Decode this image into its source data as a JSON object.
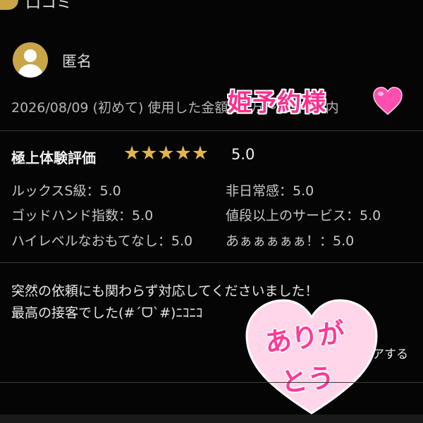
{
  "header": {
    "label": "口コミ"
  },
  "reviewer": {
    "name": "匿名"
  },
  "visit_line": "2026/08/09 (初めて) 使用した金額：1万〜2万円以内",
  "sticker_top": {
    "text": "姫予約様",
    "emoji": "heart"
  },
  "rating": {
    "title": "極上体験評価",
    "stars": "★★★★★",
    "score": "5.0"
  },
  "details": [
    {
      "label": "ルックスS級：5.0"
    },
    {
      "label": "非日常感：5.0"
    },
    {
      "label": "ゴッドハンド指数：5.0"
    },
    {
      "label": "値段以上のサービス：5.0"
    },
    {
      "label": "ハイレベルなおもてなし：5.0"
    },
    {
      "label": "あぁぁぁぁぁ！：5.0"
    }
  ],
  "comment": {
    "line1": "突然の依頼にも関わらず対応してくださいました！",
    "line2": "最高の接客でした(#´ᗜ`#)ﾆｺﾆｺ"
  },
  "share_label": "アする",
  "heart_sticker": {
    "line1": "ありが",
    "line2": "とう"
  },
  "colors": {
    "accent_gold": "#c9a548",
    "star": "#e0b74a",
    "pink": "#ff2f8f",
    "background": "#050505"
  }
}
